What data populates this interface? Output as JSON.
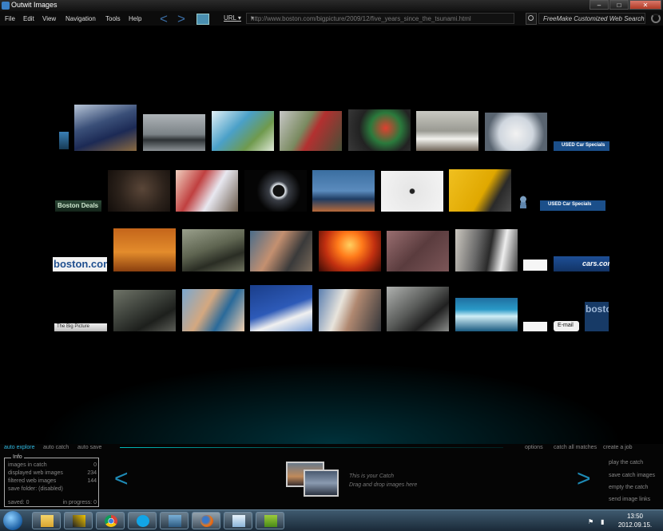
{
  "window": {
    "title": "Outwit Images",
    "controls": [
      "–",
      "□",
      "✕"
    ]
  },
  "menu": [
    "File",
    "Edit",
    "View",
    "Navigation",
    "Tools",
    "Help"
  ],
  "nav": {
    "url_label": "URL ▾",
    "url": "http://www.boston.com/bigpicture/2009/12/five_years_since_the_tsunami.html",
    "search": "FreeMake Customized Web Search"
  },
  "gallery_ads": {
    "boston_deals": "Boston Deals",
    "used_car_1": "USED Car Specials",
    "used_car_2": "USED Car Specials",
    "boston_com": "boston.com",
    "cars_com": "cars.com",
    "big_picture": "The Big Picture",
    "email": "E-mail",
    "boston_side": "bosto"
  },
  "options_bar": {
    "left": [
      "auto explore",
      "auto catch",
      "auto save"
    ],
    "right": [
      "options",
      "catch all matches",
      "create a job"
    ]
  },
  "info": {
    "title": "Info",
    "rows": [
      {
        "label": "images in catch",
        "value": "0"
      },
      {
        "label": "displayed web images",
        "value": "234"
      },
      {
        "label": "filtered web images",
        "value": "144"
      },
      {
        "label": "save folder: (disabled)",
        "value": ""
      }
    ],
    "saved": "saved: 0",
    "in_progress": "in progress: 0"
  },
  "catch": {
    "line1": "This is your Catch",
    "line2": "Drag and drop images here"
  },
  "actions": [
    "play the catch",
    "save catch images",
    "empty the catch",
    "send image links"
  ],
  "taskbar": {
    "time": "13:50",
    "date": "2012.09.15."
  },
  "colors": {
    "accent": "#1e8ab5",
    "active_option": "#2fb8e0"
  }
}
